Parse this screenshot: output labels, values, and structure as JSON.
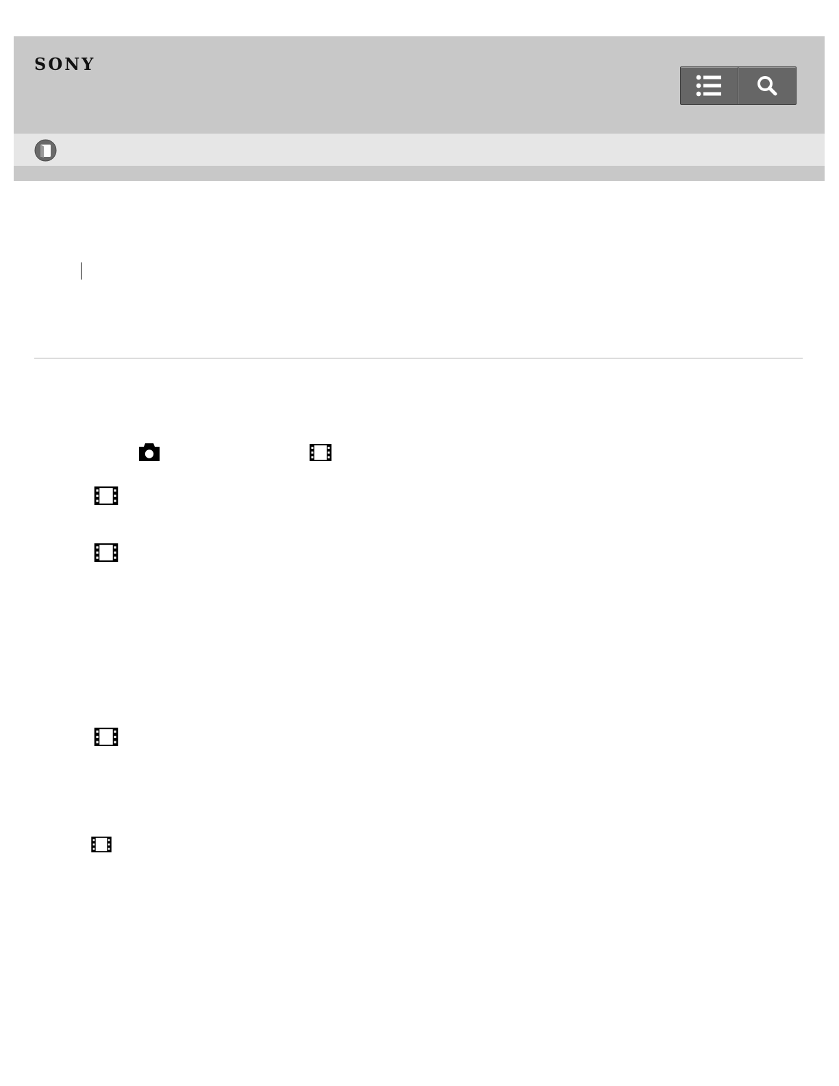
{
  "header": {
    "logo_text": "SONY",
    "buttons": [
      {
        "name": "contents-list",
        "icon": "list-icon"
      },
      {
        "name": "search",
        "icon": "search-icon"
      }
    ],
    "bg_color": "#c8c8c8",
    "button_color": "#666666"
  },
  "book_bar": {
    "icon": "book-icon",
    "bg_color": "#e6e6e6"
  },
  "content": {
    "icons": [
      {
        "name": "still-camera-icon"
      },
      {
        "name": "movie-icon"
      },
      {
        "name": "movie-icon"
      },
      {
        "name": "movie-icon"
      },
      {
        "name": "movie-icon"
      },
      {
        "name": "movie-icon"
      }
    ]
  }
}
